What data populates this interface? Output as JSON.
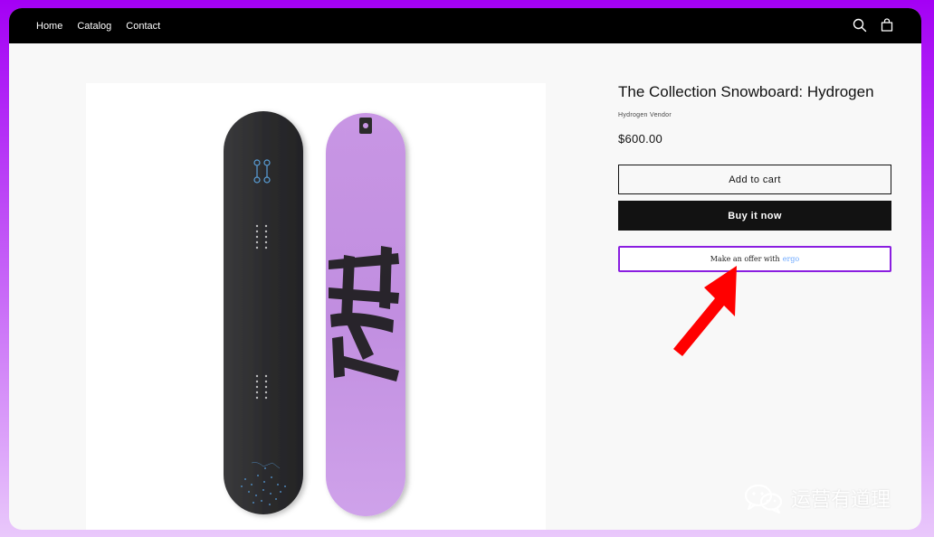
{
  "nav": {
    "links": [
      "Home",
      "Catalog",
      "Contact"
    ],
    "icons": [
      "search-icon",
      "cart-icon"
    ]
  },
  "product": {
    "title": "The Collection Snowboard: Hydrogen",
    "vendor": "Hydrogen Vendor",
    "price": "$600.00",
    "add_to_cart_label": "Add to cart",
    "buy_now_label": "Buy it now",
    "offer_label": "Make an offer with",
    "offer_brand": "ergo",
    "image_logo_text": "H2"
  },
  "watermark": {
    "text": "运营有道理"
  },
  "colors": {
    "background_gradient_top": "#a400f5",
    "background_gradient_bottom": "#e9c8fb",
    "nav_bar": "#000000",
    "buy_now": "#121212",
    "offer_border": "#8a1ee0",
    "offer_brand": "#6aa7ff",
    "arrow": "#ff0000",
    "board_dark": "#2f2f31",
    "board_purple": "#c99ae6"
  }
}
